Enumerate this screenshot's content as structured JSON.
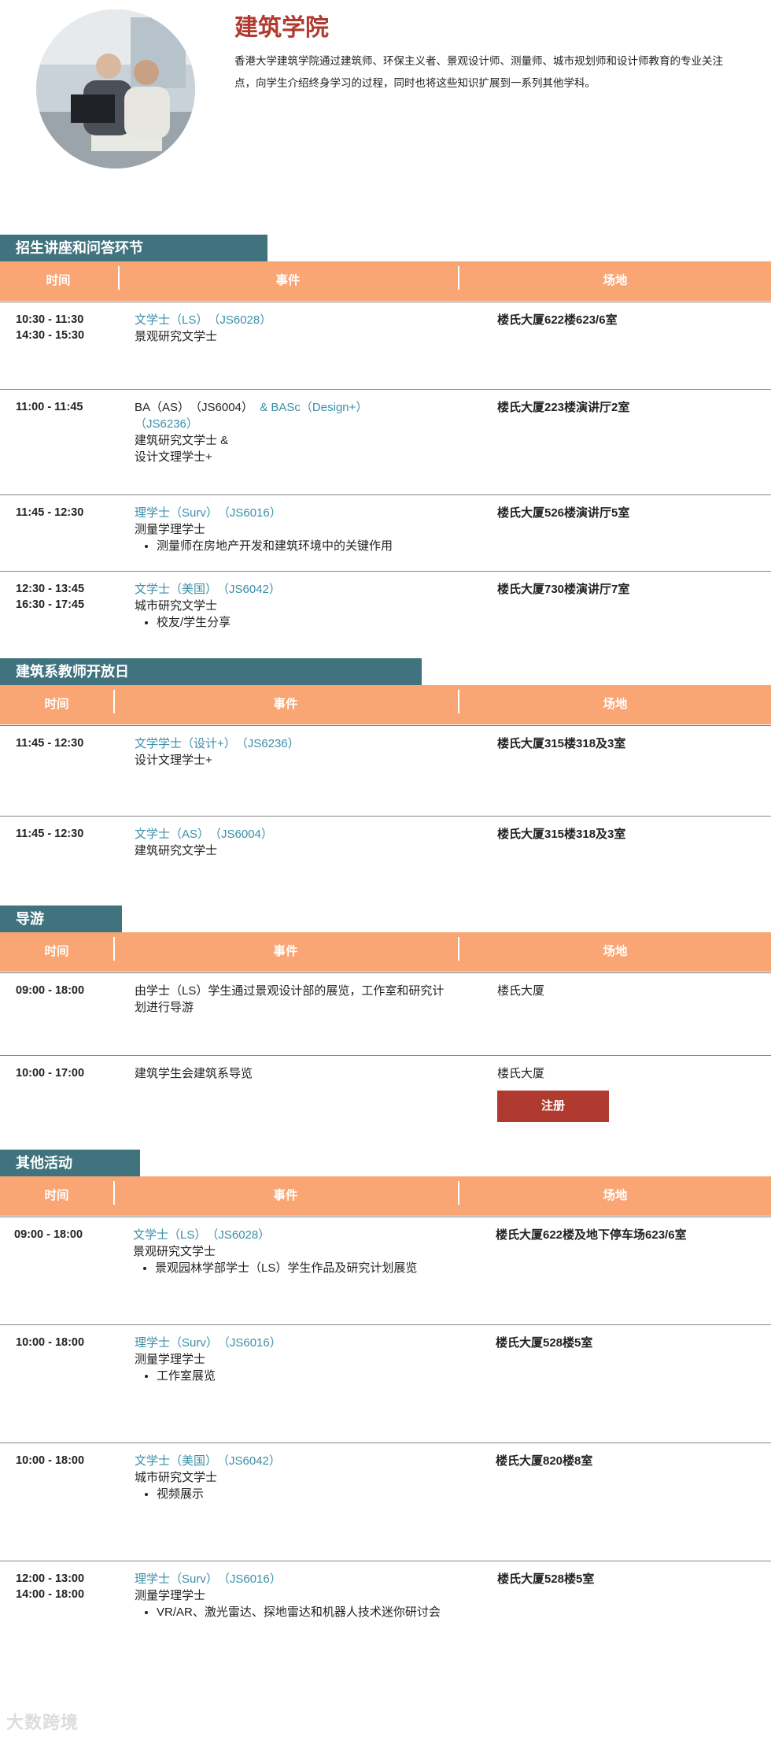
{
  "header": {
    "title": "建筑学院",
    "description": "香港大学建筑学院通过建筑师、环保主义者、景观设计师、测量师、城市规划师和设计师教育的专业关注点，向学生介绍终身学习的过程，同时也将这些知识扩展到一系列其他学科。"
  },
  "columns": {
    "time": "时间",
    "event": "事件",
    "venue": "场地"
  },
  "sections": [
    {
      "title": "招生讲座和问答环节",
      "rows": [
        {
          "time1": "10:30 - 11:30",
          "time2": "14:30 - 15:30",
          "prog": "文学士（LS）　（JS6028）",
          "sub": "景观研究文学士",
          "venue": "楼氏大厦622楼623/6室"
        },
        {
          "time1": "11:00 - 11:45",
          "prog_a": "BA（AS）　（JS6004）",
          "prog_b": "& BASc（Design+）",
          "prog_c": "（JS6236）",
          "sub1": "建筑研究文学士 &",
          "sub2": "设计文理学士+",
          "venue": "楼氏大厦223楼演讲厅2室"
        },
        {
          "time1": "11:45 - 12:30",
          "prog": "理学士（Surv）　（JS6016）",
          "sub": "测量学理学士",
          "bullet": "测量师在房地产开发和建筑环境中的关键作用",
          "venue": "楼氏大厦526楼演讲厅5室"
        },
        {
          "time1": "12:30 - 13:45",
          "time2": "16:30 - 17:45",
          "prog": "文学士（美国）　（JS6042）",
          "sub": "城市研究文学士",
          "bullet": "校友/学生分享",
          "venue": "楼氏大厦730楼演讲厅7室"
        }
      ]
    },
    {
      "title": "建筑系教师开放日",
      "rows": [
        {
          "time1": "11:45 - 12:30",
          "prog": "文学学士（设计+）　（JS6236）",
          "sub": "设计文理学士+",
          "venue": "楼氏大厦315楼318及3室"
        },
        {
          "time1": "11:45 - 12:30",
          "prog": "文学士（AS）　（JS6004）",
          "sub": "建筑研究文学士",
          "venue": "楼氏大厦315楼318及3室"
        }
      ]
    },
    {
      "title": "导游",
      "rows": [
        {
          "time1": "09:00 - 18:00",
          "text": "由学士（LS）学生通过景观设计部的展览，工作室和研究计划进行导游",
          "venue": "楼氏大厦"
        },
        {
          "time1": "10:00 - 17:00",
          "text": "建筑学生会建筑系导览",
          "venue": "楼氏大厦",
          "button": "注册"
        }
      ]
    },
    {
      "title": "其他活动",
      "rows": [
        {
          "time1": "09:00 - 18:00",
          "prog": "文学士（LS）　（JS6028）",
          "sub": "景观研究文学士",
          "bullet": "景观园林学部学士（LS）学生作品及研究计划展览",
          "venue": "楼氏大厦622楼及地下停车场623/6室"
        },
        {
          "time1": "10:00 - 18:00",
          "prog": "理学士（Surv）　（JS6016）",
          "sub": "测量学理学士",
          "bullet": "工作室展览",
          "venue": "楼氏大厦528楼5室"
        },
        {
          "time1": "10:00 - 18:00",
          "prog": "文学士（美国）　（JS6042）",
          "sub": "城市研究文学士",
          "bullet": "视频展示",
          "venue": "楼氏大厦820楼8室"
        },
        {
          "time1": "12:00 - 13:00",
          "time2": "14:00 - 18:00",
          "prog": "理学士（Surv）　（JS6016）",
          "sub": "测量学理学士",
          "bullet": "VR/AR、激光雷达、探地雷达和机器人技术迷你研讨会",
          "venue": "楼氏大厦528楼5室"
        }
      ]
    }
  ],
  "watermark": "大数跨境"
}
